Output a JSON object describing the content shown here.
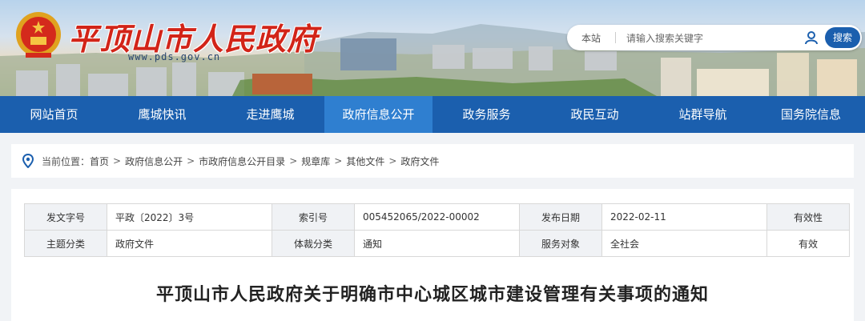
{
  "header": {
    "title": "平顶山市人民政府",
    "url": "www.pds.gov.cn",
    "emblem_icon": "national-emblem-icon"
  },
  "search": {
    "scope": "本站",
    "placeholder": "请输入搜索关键字",
    "button_label": "搜索",
    "user_icon": "user-icon"
  },
  "nav": {
    "items": [
      {
        "label": "网站首页"
      },
      {
        "label": "鹰城快讯"
      },
      {
        "label": "走进鹰城"
      },
      {
        "label": "政府信息公开"
      },
      {
        "label": "政务服务"
      },
      {
        "label": "政民互动"
      },
      {
        "label": "站群导航"
      },
      {
        "label": "国务院信息"
      }
    ],
    "active_index": 3
  },
  "breadcrumb": {
    "label": "当前位置：",
    "items": [
      "首页",
      "政府信息公开",
      "市政府信息公开目录",
      "规章库",
      "其他文件",
      "政府文件"
    ],
    "separator": ">"
  },
  "meta": {
    "row1": {
      "doc_no_label": "发文字号",
      "doc_no": "平政〔2022〕3号",
      "index_label": "索引号",
      "index": "005452065/2022-00002",
      "date_label": "发布日期",
      "date": "2022-02-11",
      "validity_label": "有效性"
    },
    "row2": {
      "topic_label": "主题分类",
      "topic": "政府文件",
      "genre_label": "体裁分类",
      "genre": "通知",
      "audience_label": "服务对象",
      "audience": "全社会",
      "validity": "有效"
    }
  },
  "document": {
    "title": "平顶山市人民政府关于明确市中心城区城市建设管理有关事项的通知"
  },
  "colors": {
    "nav_bg": "#1b5fae",
    "nav_active": "#2f7fd0",
    "title_red": "#d22418",
    "page_bg": "#f1f3f6"
  }
}
